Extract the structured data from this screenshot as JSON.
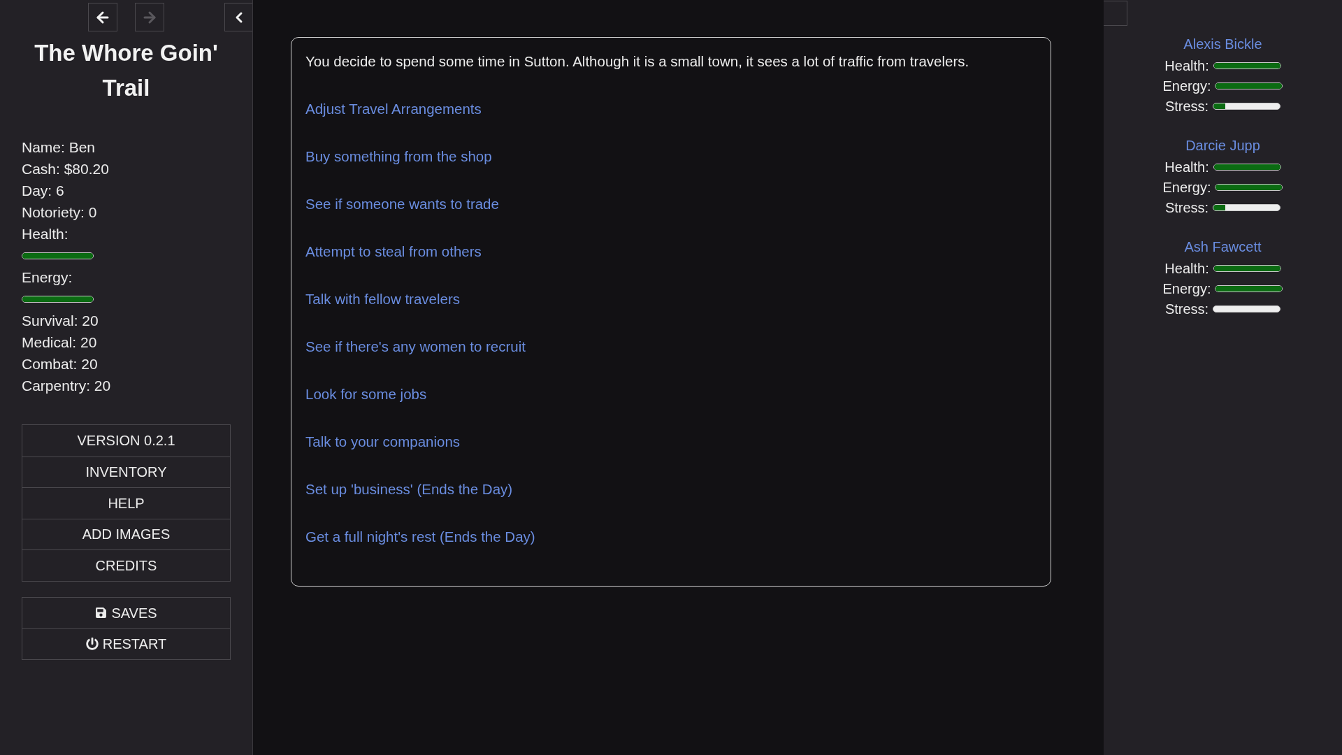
{
  "navigation": {
    "back": {
      "disabled": false
    },
    "forward": {
      "disabled": true
    }
  },
  "sidebar": {
    "title": "The Whore Goin' Trail",
    "stats": [
      {
        "kind": "text",
        "text": "Name: Ben"
      },
      {
        "kind": "text",
        "text": "Cash: $80.20"
      },
      {
        "kind": "text",
        "text": "Day: 6"
      },
      {
        "kind": "text",
        "text": "Notoriety: 0"
      },
      {
        "kind": "meter",
        "label": "Health:",
        "level": 1
      },
      {
        "kind": "meter",
        "label": "Energy:",
        "level": 1
      },
      {
        "kind": "text",
        "text": "Survival: 20"
      },
      {
        "kind": "text",
        "text": "Medical: 20"
      },
      {
        "kind": "text",
        "text": "Combat: 20"
      },
      {
        "kind": "text",
        "text": "Carpentry: 20"
      }
    ],
    "menu": [
      "VERSION 0.2.1",
      "INVENTORY",
      "HELP",
      "ADD IMAGES",
      "CREDITS"
    ],
    "system_menu": [
      {
        "kind": "save",
        "label": "SAVES"
      },
      {
        "kind": "power",
        "label": "RESTART"
      }
    ]
  },
  "story": {
    "text": "You decide to spend some time in Sutton. Although it is a small town, it sees a lot of traffic from travelers.",
    "choices": [
      "Adjust Travel Arrangements",
      "Buy something from the shop",
      "See if someone wants to trade",
      "Attempt to steal from others",
      "Talk with fellow travelers",
      "See if there's any women to recruit",
      "Look for some jobs",
      "Talk to your companions",
      "Set up 'business' (Ends the Day)",
      "Get a full night's rest (Ends the Day)"
    ]
  },
  "companions": [
    {
      "name": "Alexis Bickle",
      "meters": [
        {
          "label": "Health:",
          "level": 1
        },
        {
          "label": "Energy:",
          "level": 1
        },
        {
          "label": "Stress:",
          "level": 0.18
        }
      ]
    },
    {
      "name": "Darcie Jupp",
      "meters": [
        {
          "label": "Health:",
          "level": 1
        },
        {
          "label": "Energy:",
          "level": 1
        },
        {
          "label": "Stress:",
          "level": 0.18
        }
      ]
    },
    {
      "name": "Ash Fawcett",
      "meters": [
        {
          "label": "Health:",
          "level": 1
        },
        {
          "label": "Energy:",
          "level": 1
        },
        {
          "label": "Stress:",
          "level": 0
        }
      ]
    }
  ]
}
